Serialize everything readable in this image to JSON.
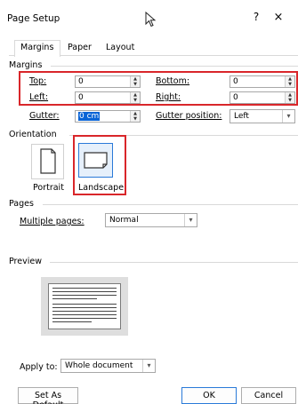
{
  "window": {
    "title": "Page Setup",
    "help": "?",
    "close": "×"
  },
  "tabs": [
    {
      "label": "Margins",
      "active": true
    },
    {
      "label": "Paper",
      "active": false
    },
    {
      "label": "Layout",
      "active": false
    }
  ],
  "margins": {
    "section": "Margins",
    "top": {
      "label": "Top:",
      "value": "0"
    },
    "bottom": {
      "label": "Bottom:",
      "value": "0"
    },
    "left": {
      "label": "Left:",
      "value": "0"
    },
    "right": {
      "label": "Right:",
      "value": "0"
    },
    "gutter": {
      "label": "Gutter:",
      "value": "0 cm"
    },
    "gutter_position": {
      "label": "Gutter position:",
      "value": "Left"
    }
  },
  "orientation": {
    "section": "Orientation",
    "portrait": "Portrait",
    "landscape": "Landscape",
    "selected": "landscape"
  },
  "pages": {
    "section": "Pages",
    "multiple_label": "Multiple pages:",
    "multiple_value": "Normal"
  },
  "preview": {
    "section": "Preview"
  },
  "apply": {
    "label": "Apply to:",
    "value": "Whole document"
  },
  "buttons": {
    "set_default": "Set As Default",
    "ok": "OK",
    "cancel": "Cancel"
  },
  "colors": {
    "highlight": "#d9262a",
    "accent": "#0a64d6"
  },
  "icons": {
    "cursor": "mouse-pointer-icon",
    "spin": "spin-arrows-icon",
    "dropdown": "chevron-down-icon"
  }
}
